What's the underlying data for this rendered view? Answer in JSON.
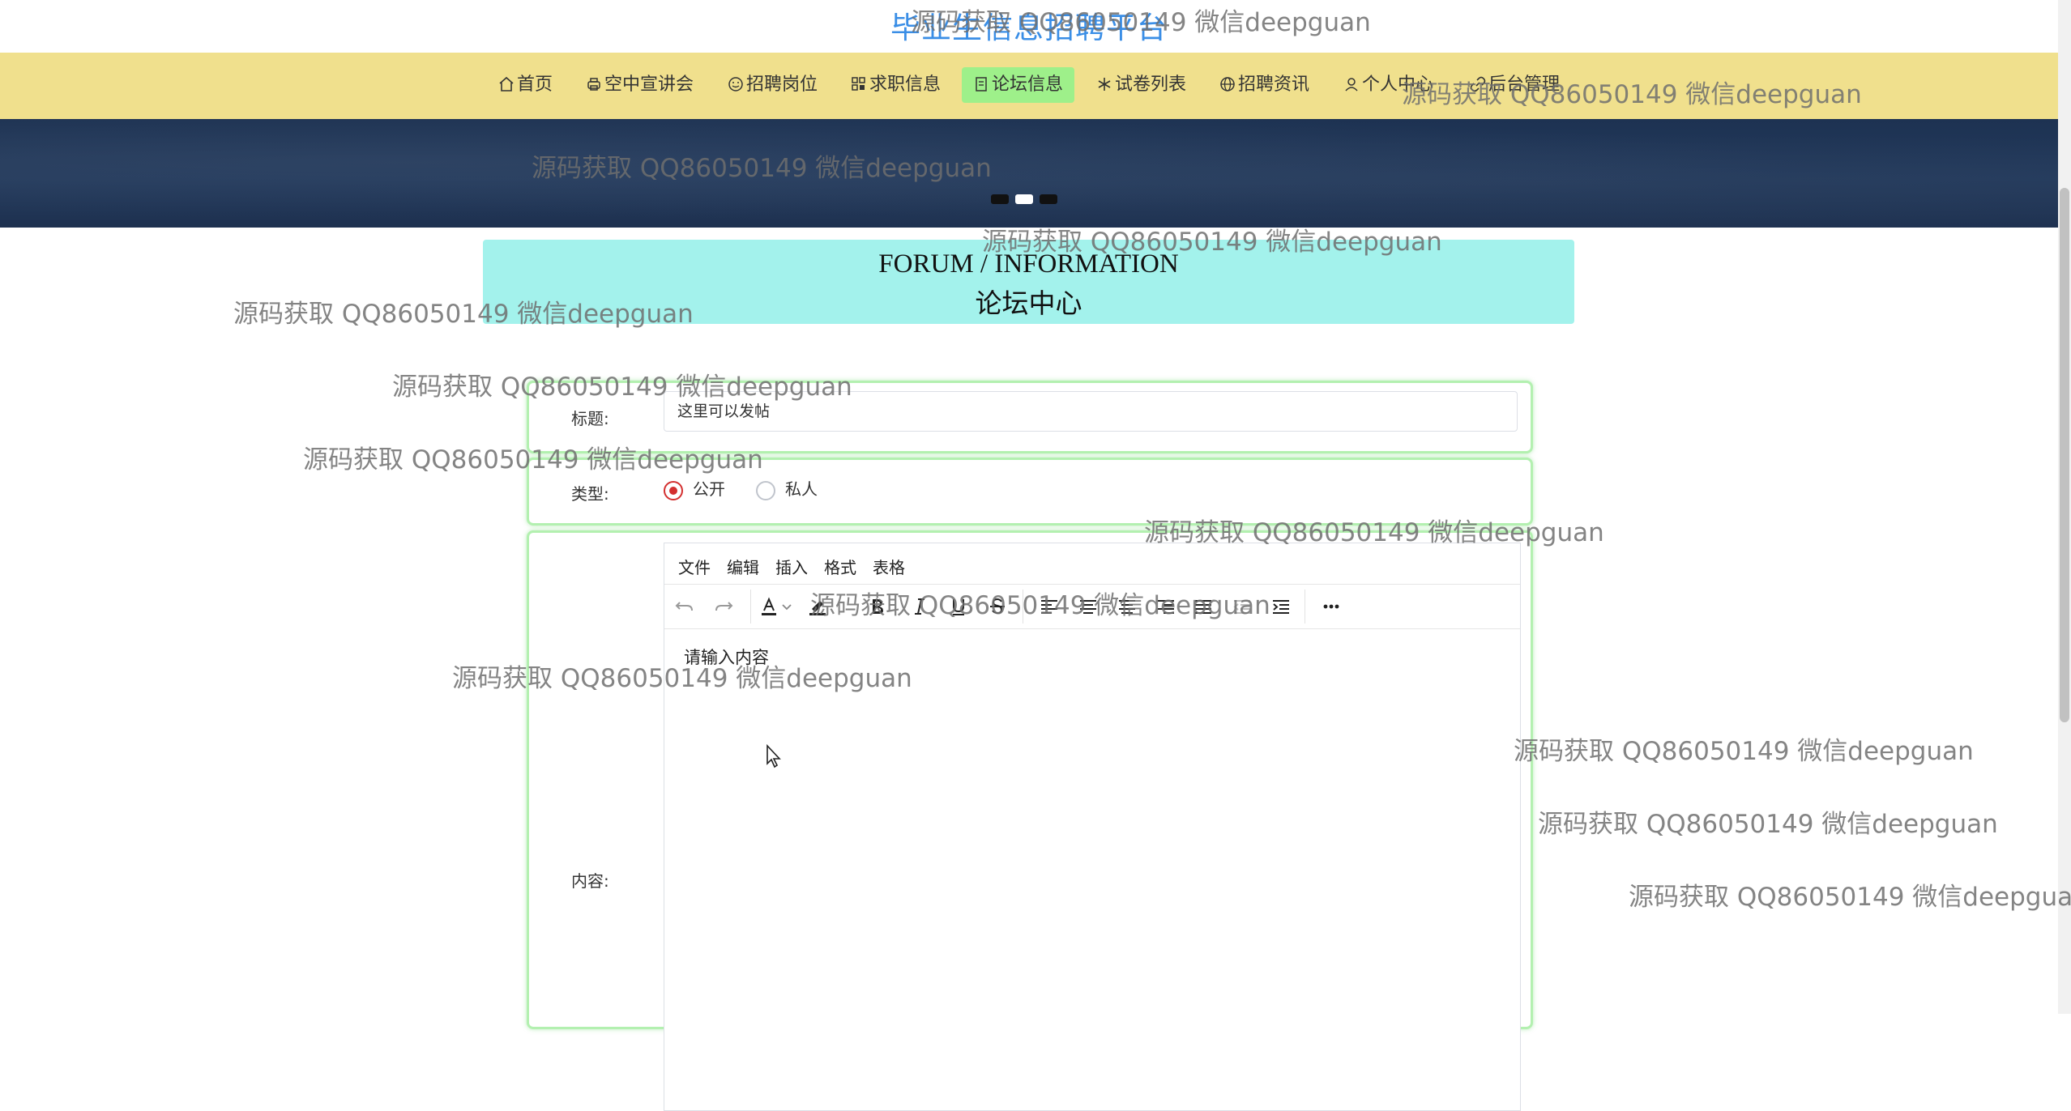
{
  "site": {
    "title": "毕业生信息招聘平台"
  },
  "nav": {
    "items": [
      {
        "label": "首页",
        "icon": "home-icon"
      },
      {
        "label": "空中宣讲会",
        "icon": "printer-icon"
      },
      {
        "label": "招聘岗位",
        "icon": "smile-icon"
      },
      {
        "label": "求职信息",
        "icon": "grid-icon"
      },
      {
        "label": "论坛信息",
        "icon": "document-icon",
        "active": true
      },
      {
        "label": "试卷列表",
        "icon": "snowflake-icon"
      },
      {
        "label": "招聘资讯",
        "icon": "globe-icon"
      },
      {
        "label": "个人中心",
        "icon": "user-icon"
      },
      {
        "label": "后台管理",
        "icon": "link-icon"
      }
    ],
    "active_color": "#9ef08a",
    "bar_color": "#f0e08d"
  },
  "carousel": {
    "slides": 3,
    "active": 2
  },
  "forum_header": {
    "en": "FORUM / INFORMATION",
    "cn": "论坛中心",
    "color": "#a3f2ec"
  },
  "form": {
    "title_label": "标题:",
    "title_value": "这里可以发帖",
    "type_label": "类型:",
    "type_options": [
      {
        "label": "公开",
        "checked": true
      },
      {
        "label": "私人",
        "checked": false
      }
    ],
    "content_label": "内容:"
  },
  "editor": {
    "menu": [
      "文件",
      "编辑",
      "插入",
      "格式",
      "表格"
    ],
    "toolbar": [
      "undo-icon",
      "redo-icon",
      "font-color-icon",
      "highlight-icon",
      "bold-icon",
      "italic-icon",
      "underline-icon",
      "strikethrough-icon",
      "align-left-icon",
      "align-center-icon",
      "align-center-2-icon",
      "align-right-icon",
      "justify-icon",
      "outdent-icon",
      "indent-icon",
      "more-icon"
    ],
    "placeholder": "请输入内容"
  },
  "watermark": "源码获取 QQ86050149 微信deepguan"
}
